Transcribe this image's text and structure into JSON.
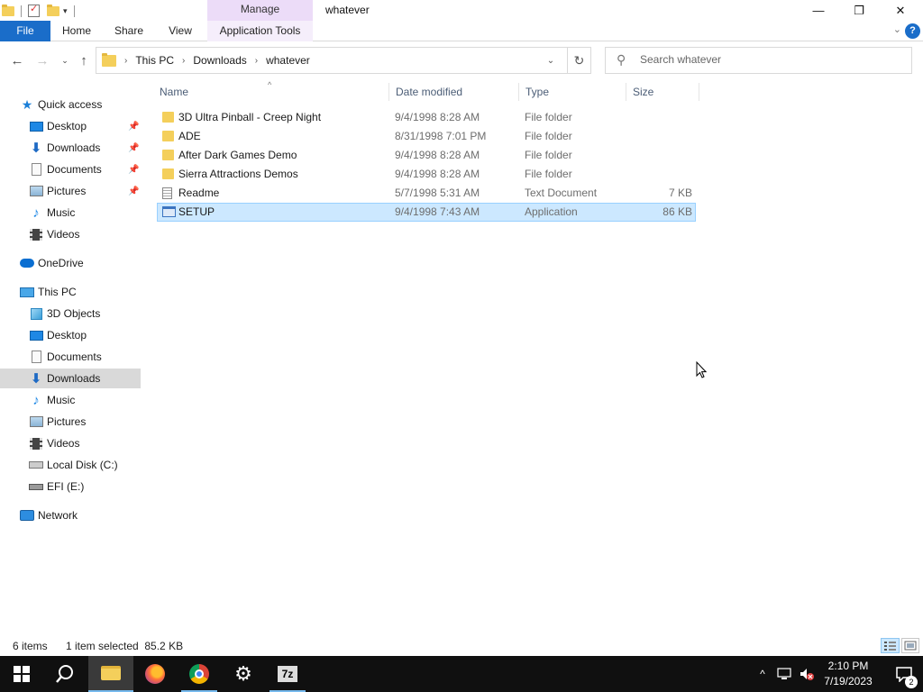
{
  "window": {
    "title": "whatever",
    "manage_tab": "Manage",
    "minimize_icon": "—",
    "restore_icon": "❐",
    "close_icon": "✕"
  },
  "ribbon": {
    "tabs": [
      {
        "label": "File"
      },
      {
        "label": "Home"
      },
      {
        "label": "Share"
      },
      {
        "label": "View"
      },
      {
        "label": "Application Tools"
      }
    ],
    "help": "?"
  },
  "address": {
    "crumbs": [
      "This PC",
      "Downloads",
      "whatever"
    ],
    "search_placeholder": "Search whatever"
  },
  "navpane": {
    "items": [
      {
        "label": "Quick access",
        "icon": "star-icon"
      },
      {
        "label": "Desktop",
        "icon": "desktop-icon",
        "pinned": true
      },
      {
        "label": "Downloads",
        "icon": "download-icon",
        "pinned": true
      },
      {
        "label": "Documents",
        "icon": "documents-icon",
        "pinned": true
      },
      {
        "label": "Pictures",
        "icon": "pictures-icon",
        "pinned": true
      },
      {
        "label": "Music",
        "icon": "music-icon"
      },
      {
        "label": "Videos",
        "icon": "videos-icon"
      },
      {
        "label": "OneDrive",
        "icon": "onedrive-icon"
      },
      {
        "label": "This PC",
        "icon": "this-pc-icon"
      },
      {
        "label": "3D Objects",
        "icon": "3d-objects-icon"
      },
      {
        "label": "Desktop",
        "icon": "desktop-icon"
      },
      {
        "label": "Documents",
        "icon": "documents-icon"
      },
      {
        "label": "Downloads",
        "icon": "download-icon",
        "selected": true
      },
      {
        "label": "Music",
        "icon": "music-icon"
      },
      {
        "label": "Pictures",
        "icon": "pictures-icon"
      },
      {
        "label": "Videos",
        "icon": "videos-icon"
      },
      {
        "label": "Local Disk (C:)",
        "icon": "local-disk-icon"
      },
      {
        "label": "EFI (E:)",
        "icon": "drive-icon"
      },
      {
        "label": "Network",
        "icon": "network-icon"
      }
    ]
  },
  "filelist": {
    "columns": [
      "Name",
      "Date modified",
      "Type",
      "Size"
    ],
    "rows": [
      {
        "name": "3D Ultra Pinball - Creep Night",
        "date": "9/4/1998 8:28 AM",
        "type": "File folder",
        "size": "",
        "icon": "folder-icon"
      },
      {
        "name": "ADE",
        "date": "8/31/1998 7:01 PM",
        "type": "File folder",
        "size": "",
        "icon": "folder-icon"
      },
      {
        "name": "After Dark Games Demo",
        "date": "9/4/1998 8:28 AM",
        "type": "File folder",
        "size": "",
        "icon": "folder-icon"
      },
      {
        "name": "Sierra Attractions Demos",
        "date": "9/4/1998 8:28 AM",
        "type": "File folder",
        "size": "",
        "icon": "folder-icon"
      },
      {
        "name": "Readme",
        "date": "5/7/1998 5:31 AM",
        "type": "Text Document",
        "size": "7 KB",
        "icon": "text-file-icon"
      },
      {
        "name": "SETUP",
        "date": "9/4/1998 7:43 AM",
        "type": "Application",
        "size": "86 KB",
        "icon": "application-icon",
        "selected": true
      }
    ]
  },
  "status": {
    "count": "6 items",
    "selection": "1 item selected  85.2 KB"
  },
  "taskbar": {
    "app_7z_label": "7z",
    "time": "2:10 PM",
    "date": "7/19/2023",
    "notifications": "2"
  },
  "colors": {
    "accent": "#1a6dc9",
    "selection": "#cce8ff",
    "manage_tab": "#ecdcf8",
    "taskbar": "#101010"
  }
}
